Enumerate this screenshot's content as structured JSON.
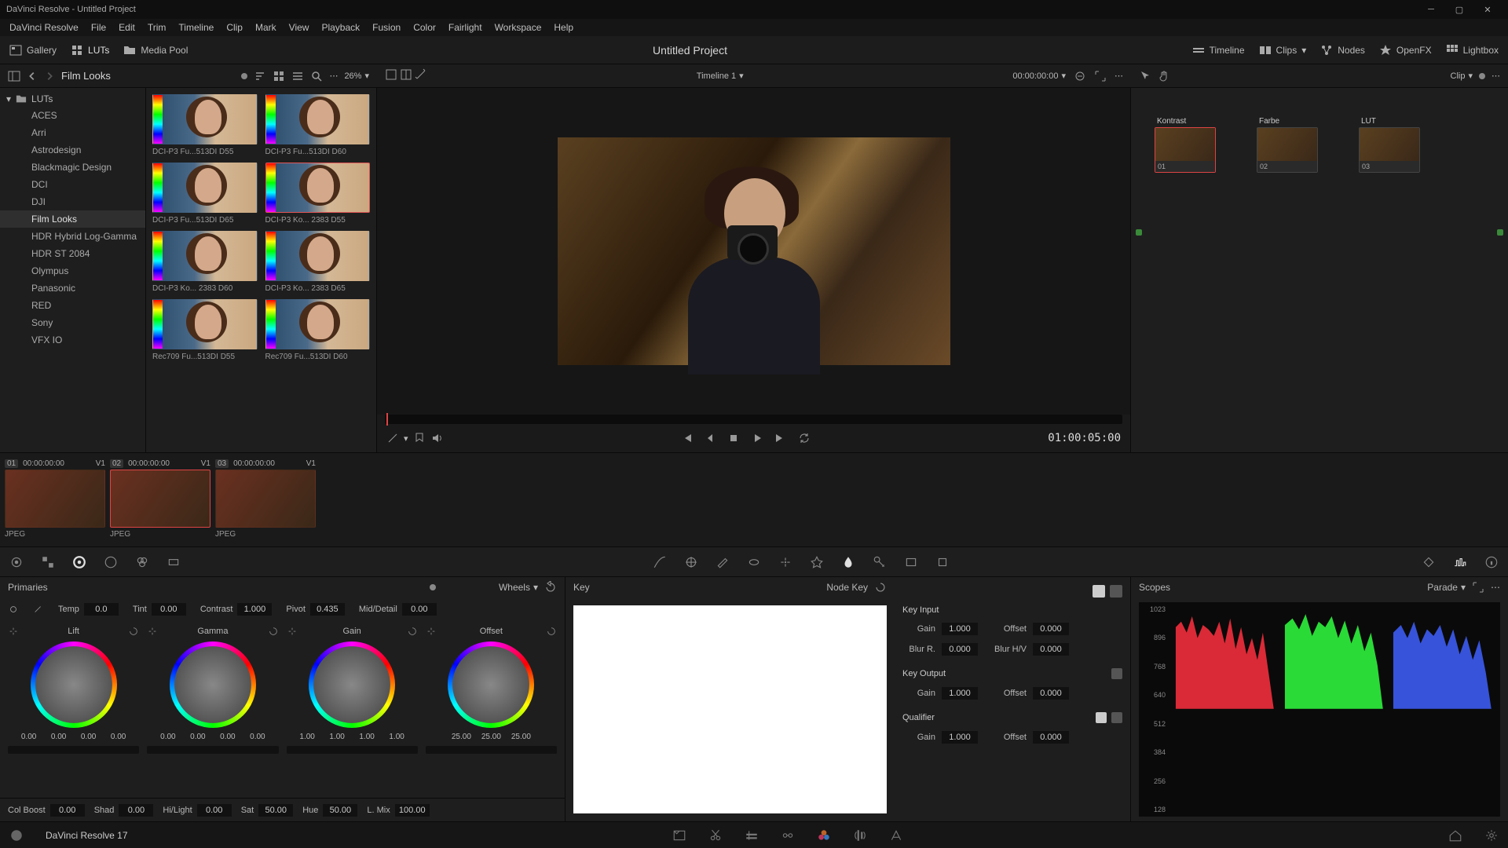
{
  "titlebar": "DaVinci Resolve - Untitled Project",
  "menubar": [
    "DaVinci Resolve",
    "File",
    "Edit",
    "Trim",
    "Timeline",
    "Clip",
    "Mark",
    "View",
    "Playback",
    "Fusion",
    "Color",
    "Fairlight",
    "Workspace",
    "Help"
  ],
  "topbar": {
    "gallery": "Gallery",
    "luts": "LUTs",
    "mediapool": "Media Pool",
    "project": "Untitled Project",
    "timeline": "Timeline",
    "clips": "Clips",
    "nodes": "Nodes",
    "openfx": "OpenFX",
    "lightbox": "Lightbox"
  },
  "secondrow": {
    "leftTitle": "Film Looks",
    "zoom": "26%",
    "timeline": "Timeline 1",
    "timecode": "00:00:00:00",
    "clipmode": "Clip"
  },
  "luts": {
    "root": "LUTs",
    "categories": [
      "ACES",
      "Arri",
      "Astrodesign",
      "Blackmagic Design",
      "DCI",
      "DJI",
      "Film Looks",
      "HDR Hybrid Log-Gamma",
      "HDR ST 2084",
      "Olympus",
      "Panasonic",
      "RED",
      "Sony",
      "VFX IO"
    ],
    "activeCategory": "Film Looks",
    "thumbs": [
      "DCI-P3 Fu...513DI D55",
      "DCI-P3 Fu...513DI D60",
      "DCI-P3 Fu...513DI D65",
      "DCI-P3 Ko... 2383 D55",
      "DCI-P3 Ko... 2383 D60",
      "DCI-P3 Ko... 2383 D65",
      "Rec709 Fu...513DI D55",
      "Rec709 Fu...513DI D60"
    ],
    "selectedThumb": 3
  },
  "viewer": {
    "tc": "01:00:05:00"
  },
  "nodes": {
    "items": [
      {
        "label": "Kontrast",
        "num": "01"
      },
      {
        "label": "Farbe",
        "num": "02"
      },
      {
        "label": "LUT",
        "num": "03"
      }
    ]
  },
  "clips": [
    {
      "num": "01",
      "tc": "00:00:00:00",
      "v": "V1",
      "fmt": "JPEG",
      "sel": false
    },
    {
      "num": "02",
      "tc": "00:00:00:00",
      "v": "V1",
      "fmt": "JPEG",
      "sel": true
    },
    {
      "num": "03",
      "tc": "00:00:00:00",
      "v": "V1",
      "fmt": "JPEG",
      "sel": false
    }
  ],
  "primaries": {
    "title": "Primaries",
    "mode": "Wheels",
    "temp": {
      "label": "Temp",
      "val": "0.0"
    },
    "tint": {
      "label": "Tint",
      "val": "0.00"
    },
    "contrast": {
      "label": "Contrast",
      "val": "1.000"
    },
    "pivot": {
      "label": "Pivot",
      "val": "0.435"
    },
    "middetail": {
      "label": "Mid/Detail",
      "val": "0.00"
    },
    "wheels": [
      {
        "name": "Lift",
        "vals": [
          "0.00",
          "0.00",
          "0.00",
          "0.00"
        ]
      },
      {
        "name": "Gamma",
        "vals": [
          "0.00",
          "0.00",
          "0.00",
          "0.00"
        ]
      },
      {
        "name": "Gain",
        "vals": [
          "1.00",
          "1.00",
          "1.00",
          "1.00"
        ]
      },
      {
        "name": "Offset",
        "vals": [
          "25.00",
          "25.00",
          "25.00"
        ]
      }
    ],
    "footer": [
      {
        "label": "Col Boost",
        "val": "0.00"
      },
      {
        "label": "Shad",
        "val": "0.00"
      },
      {
        "label": "Hi/Light",
        "val": "0.00"
      },
      {
        "label": "Sat",
        "val": "50.00"
      },
      {
        "label": "Hue",
        "val": "50.00"
      },
      {
        "label": "L. Mix",
        "val": "100.00"
      }
    ]
  },
  "key": {
    "title": "Key",
    "nodekey": "Node Key",
    "input": {
      "label": "Key Input",
      "gain": "1.000",
      "offset": "0.000",
      "blurr": "0.000",
      "blurhv": "0.000"
    },
    "output": {
      "label": "Key Output",
      "gain": "1.000",
      "offset": "0.000"
    },
    "qualifier": {
      "label": "Qualifier",
      "gain": "1.000",
      "offset": "0.000"
    },
    "labels": {
      "gain": "Gain",
      "offset": "Offset",
      "blurr": "Blur R.",
      "blurhv": "Blur H/V"
    }
  },
  "scopes": {
    "title": "Scopes",
    "mode": "Parade",
    "scale": [
      "1023",
      "896",
      "768",
      "640",
      "512",
      "384",
      "256",
      "128"
    ]
  },
  "pagebar": {
    "app": "DaVinci Resolve 17"
  }
}
